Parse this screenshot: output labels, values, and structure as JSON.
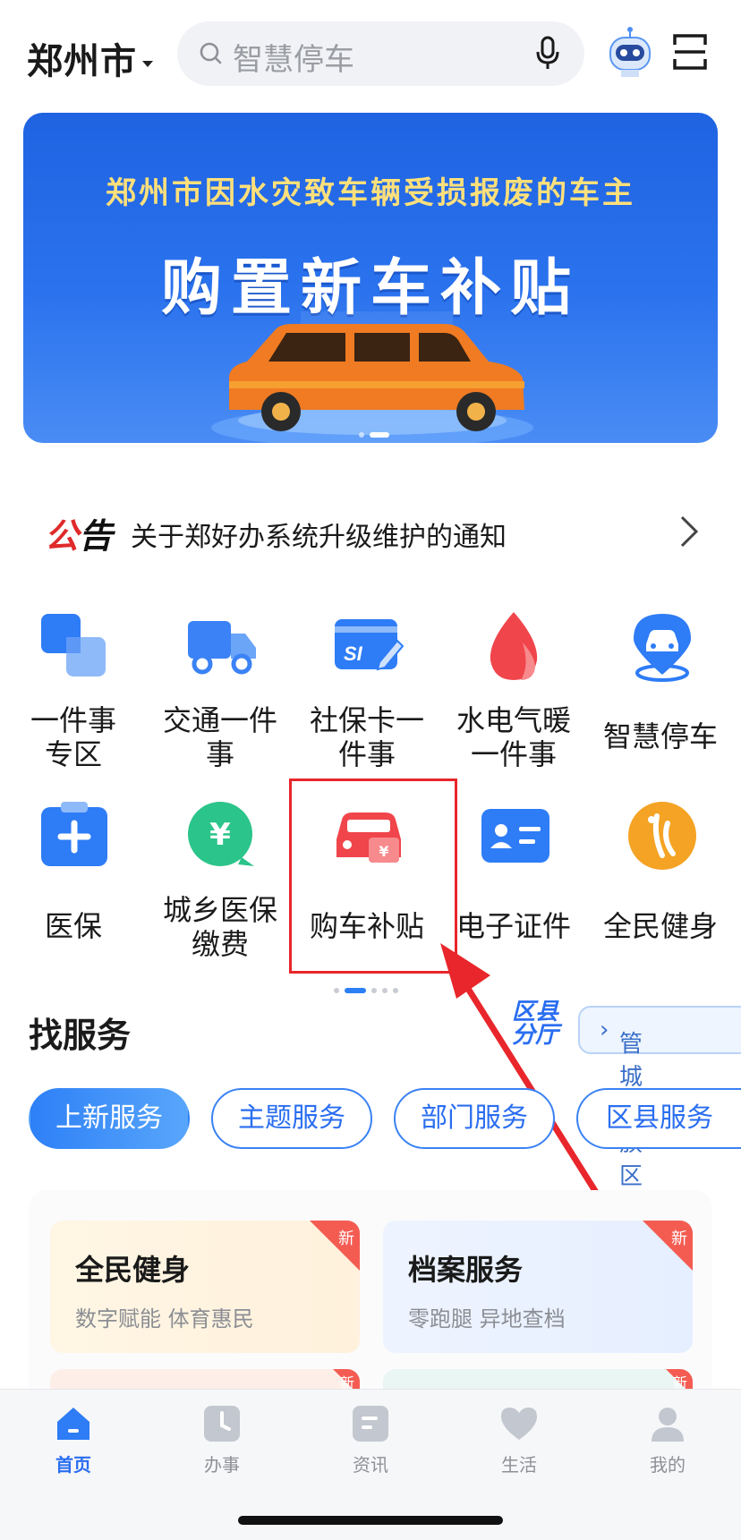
{
  "header": {
    "city": "郑州市",
    "search_placeholder": "智慧停车"
  },
  "banner": {
    "subtitle": "郑州市因水灾致车辆受损报废的车主",
    "title": "购置新车补贴"
  },
  "notice": {
    "badge_red": "公",
    "badge_black": "告",
    "text": "关于郑好办系统升级维护的通知"
  },
  "grid": [
    {
      "line1": "一件事",
      "line2": "专区",
      "icon": "squares-icon"
    },
    {
      "line1": "交通一件",
      "line2": "事",
      "icon": "truck-icon"
    },
    {
      "line1": "社保卡一",
      "line2": "件事",
      "icon": "si-card-icon"
    },
    {
      "line1": "水电气暖",
      "line2": "一件事",
      "icon": "flame-icon"
    },
    {
      "line1": "智慧停车",
      "line2": "",
      "icon": "parking-location-icon"
    },
    {
      "line1": "医保",
      "line2": "",
      "icon": "medical-clipboard-icon"
    },
    {
      "line1": "城乡医保",
      "line2": "缴费",
      "icon": "yuan-chat-icon"
    },
    {
      "line1": "购车补贴",
      "line2": "",
      "icon": "car-subsidy-icon"
    },
    {
      "line1": "电子证件",
      "line2": "",
      "icon": "id-card-icon"
    },
    {
      "line1": "全民健身",
      "line2": "",
      "icon": "fitness-logo-icon"
    }
  ],
  "find_services": {
    "title": "找服务",
    "district_logo": [
      "区县",
      "分厅"
    ],
    "district_link": "管城回族区",
    "tabs": [
      "上新服务",
      "主题服务",
      "部门服务",
      "区县服务"
    ]
  },
  "cards": [
    {
      "title": "全民健身",
      "desc": "数字赋能 体育惠民",
      "badge": "新"
    },
    {
      "title": "档案服务",
      "desc": "零跑腿 异地查档",
      "badge": "新"
    },
    {
      "badge": "新"
    },
    {
      "badge": "新"
    }
  ],
  "tabbar": [
    {
      "label": "首页",
      "icon": "home-icon",
      "active": true
    },
    {
      "label": "办事",
      "icon": "clock-icon",
      "active": false
    },
    {
      "label": "资讯",
      "icon": "news-icon",
      "active": false
    },
    {
      "label": "生活",
      "icon": "heart-icon",
      "active": false
    },
    {
      "label": "我的",
      "icon": "user-icon",
      "active": false
    }
  ],
  "colors": {
    "accent": "#2a6ef0",
    "highlight": "#e8262b",
    "new_badge": "#f45c52"
  }
}
